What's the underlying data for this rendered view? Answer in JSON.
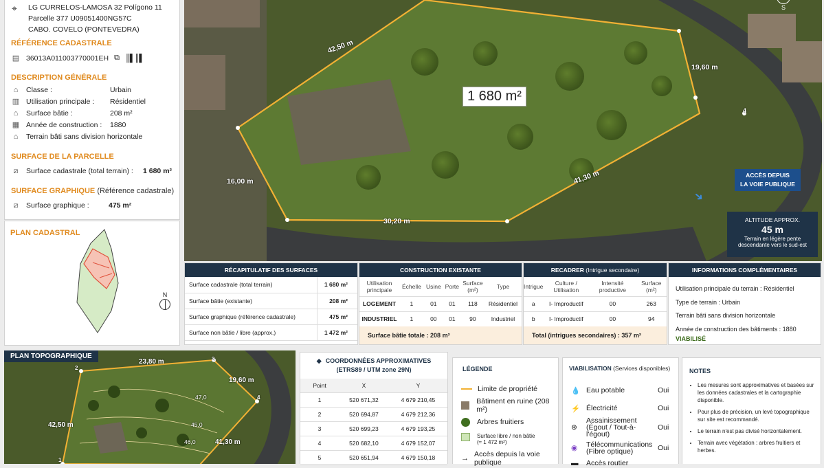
{
  "address": [
    "LG CURRELOS-LAMOSA 32 Polígono 11",
    "Parcelle 377 U09051400NG57C",
    "CABO. COVELO (PONTEVEDRA)"
  ],
  "ref": {
    "title": "RÉFÉRENCE CADASTRALE",
    "value": "36013A011003770001EH"
  },
  "desc": {
    "title": "DESCRIPTION GÉNÉRALE",
    "rows": [
      {
        "label": "Classe :",
        "value": "Urbain",
        "icon": "house-icon"
      },
      {
        "label": "Utilisation principale :",
        "value": "Résidentiel",
        "icon": "building-icon"
      },
      {
        "label": "Surface bâtie :",
        "value": "208 m²",
        "icon": "ruler-house-icon"
      },
      {
        "label": "Année de construction :",
        "value": "1880",
        "icon": "calendar-icon"
      },
      {
        "label": "Terrain bâti sans division horizontale",
        "value": "",
        "icon": "house-outline-icon"
      }
    ]
  },
  "parcelle": {
    "title": "SURFACE DE LA PARCELLE",
    "label": "Surface cadastrale (total terrain) :",
    "value": "1 680 m²"
  },
  "graph": {
    "title": "SURFACE GRAPHIQUE",
    "subtitle": "(Référence cadastrale)",
    "label": "Surface graphique :",
    "value": "475 m²"
  },
  "plan": {
    "title": "PLAN CADASTRAL",
    "north": "N"
  },
  "aerial": {
    "area": "1 680 m²",
    "d1": "42,50 m",
    "d2": "19,60 m",
    "d3": "16,00 m",
    "d4": "30,20 m",
    "d5": "41,30 m",
    "vertex4": "4",
    "compass": "S",
    "access": [
      "ACCÈS DEPUIS",
      "LA VOIE PUBLIQUE"
    ],
    "alt": {
      "title": "ALTITUDE APPROX.",
      "value": "45 m",
      "note": [
        "Terrain en légère pente",
        "descendante vers le sud-est"
      ]
    }
  },
  "recap": {
    "title": "RÉCAPITULATIF DES SURFACES",
    "rows": [
      {
        "l": "Surface cadastrale (total terrain)",
        "v": "1 680 m²"
      },
      {
        "l": "Surface bâtie (existante)",
        "v": "208 m²"
      },
      {
        "l": "Surface graphique (référence cadastrale)",
        "v": "475 m²"
      },
      {
        "l": "Surface non bâtie / libre (approx.)",
        "v": "1 472 m²"
      }
    ]
  },
  "constr": {
    "title": "CONSTRUCTION EXISTANTE",
    "headers": [
      "Utilisation principale",
      "Échelle",
      "Usine",
      "Porte",
      "Surface (m²)",
      "Type"
    ],
    "rows": [
      [
        "LOGEMENT",
        "1",
        "01",
        "01",
        "118",
        "Résidentiel"
      ],
      [
        "INDUSTRIEL",
        "1",
        "00",
        "01",
        "90",
        "Industriel"
      ]
    ],
    "total_label": "Surface bâtie totale :",
    "total_value": "208 m²"
  },
  "recad": {
    "title": "RECADRER",
    "subtitle": "(Intrigue secondaire)",
    "headers": [
      "Intrigue",
      "Culture / Utilisation",
      "Intensité productive",
      "Surface (m²)"
    ],
    "rows": [
      [
        "a",
        "I- Improductif",
        "00",
        "263"
      ],
      [
        "b",
        "I- Improductif",
        "00",
        "94"
      ]
    ],
    "total": "Total (intrigues secondaires) : 357 m²"
  },
  "info": {
    "title": "INFORMATIONS COMPLÉMENTAIRES",
    "lines": [
      "Utilisation principale du terrain : Résidentiel",
      "Type de terrain : Urbain",
      "Terrain bâti sans division horizontale",
      "Année de construction des bâtiments : 1880"
    ],
    "status": "VIABILISÉ"
  },
  "topo": {
    "title": "PLAN TOPOGRAPHIQUE",
    "d1": "23,80 m",
    "d2": "19,60 m",
    "d3": "42,50 m",
    "d4": "41,30 m",
    "c1": "47,0",
    "c2": "45,0",
    "c3": "46,0",
    "p1": "1",
    "p2": "2",
    "p3": "3",
    "p4": "4"
  },
  "coords": {
    "title": [
      "COORDONNÉES APPROXIMATIVES",
      "(ETRS89 / UTM zone 29N)"
    ],
    "headers": [
      "Point",
      "X",
      "Y"
    ],
    "rows": [
      [
        "1",
        "520 671,32",
        "4 679 210,45"
      ],
      [
        "2",
        "520 694,87",
        "4 679 212,36"
      ],
      [
        "3",
        "520 699,23",
        "4 679 193,25"
      ],
      [
        "4",
        "520 682,10",
        "4 679 152,07"
      ],
      [
        "5",
        "520 651,94",
        "4 679 150,18"
      ]
    ]
  },
  "legend": {
    "title": "LÉGENDE",
    "items": [
      {
        "label": "Limite de propriété",
        "icon": "boundary-line-icon"
      },
      {
        "label": "Bâtiment en ruine (208 m²)",
        "icon": "ruin-icon"
      },
      {
        "label": "Arbres fruitiers",
        "icon": "tree-icon"
      },
      {
        "label": "Surface libre / non bâtie",
        "sub": "(≈ 1 472 m²)",
        "icon": "green-square-icon"
      },
      {
        "label": "Accès depuis la voie publique",
        "icon": "arrow-icon"
      }
    ]
  },
  "viab": {
    "title": "VIABILISATION",
    "subtitle": "(Services disponibles)",
    "items": [
      {
        "label": "Eau potable",
        "sub": "",
        "v": "Oui",
        "icon": "water-drop-icon"
      },
      {
        "label": "Électricité",
        "sub": "",
        "v": "Oui",
        "icon": "lightning-icon"
      },
      {
        "label": "Assainissement",
        "sub": "(Égout / Tout-à-l'égout)",
        "v": "Oui",
        "icon": "sewer-icon"
      },
      {
        "label": "Télécommunications",
        "sub": "(Fibre optique)",
        "v": "Oui",
        "icon": "wifi-icon"
      },
      {
        "label": "Accès routier",
        "sub": "",
        "v": "",
        "icon": "road-icon"
      }
    ]
  },
  "notes": {
    "title": "NOTES",
    "items": [
      "Les mesures sont approximatives et basées sur les données cadastrales et la cartographie disponible.",
      "Pour plus de précision, un levé topographique sur site est recommandé.",
      "Le terrain n'est pas divisé horizontalement.",
      "Terrain avec végétation : arbres fruitiers et herbes."
    ]
  },
  "colors": {
    "accent": "#e08a1e",
    "navy": "#1f3347",
    "green": "#3f6e1f"
  }
}
